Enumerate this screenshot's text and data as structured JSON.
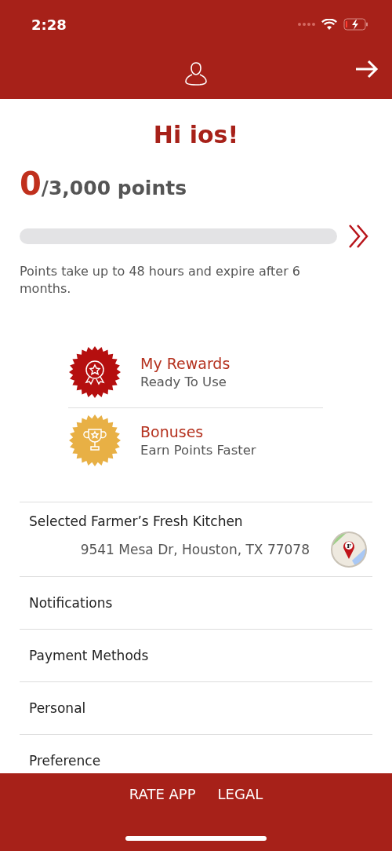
{
  "status_bar": {
    "time": "2:28"
  },
  "greeting": "Hi ios!",
  "points": {
    "current": "0",
    "goal": "/3,000 points",
    "level": 0,
    "note": "Points take up to 48 hours and expire after 6 months."
  },
  "rewards": [
    {
      "kind": "rewards",
      "title": "My Rewards",
      "subtitle": "Ready To Use",
      "color": "#b50f0f"
    },
    {
      "kind": "bonuses",
      "title": "Bonuses",
      "subtitle": "Earn Points Faster",
      "color": "#e8b045"
    }
  ],
  "store": {
    "label": "Selected Farmer’s Fresh Kitchen",
    "address": "9541 Mesa Dr, Houston, TX 77078",
    "map_pin_label": "F"
  },
  "menu": [
    "Notifications",
    "Payment Methods",
    "Personal",
    "Preference"
  ],
  "footer": {
    "links": [
      "RATE APP",
      "LEGAL"
    ]
  }
}
